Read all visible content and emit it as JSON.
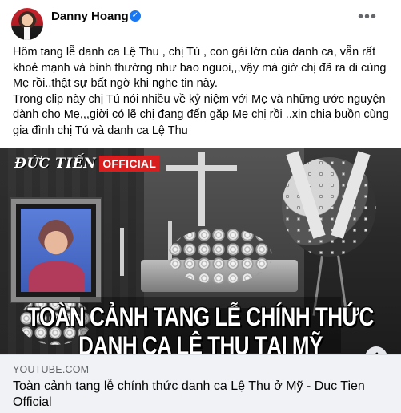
{
  "post": {
    "author": "Danny Hoang",
    "verified_icon": "verified-check-icon",
    "more_icon": "more-options-icon",
    "paragraph_1": "Hôm tang lễ danh ca Lệ Thu , chị Tú , con gái lớn của danh ca, vẫn rất khoẻ mạnh và bình thường như bao nguoi,,,vậy mà giờ chị đã ra di cùng Mẹ rồi..thật sự bất ngờ khi nghe tin này.",
    "paragraph_2": "Trong clip này chị Tú nói nhiều về kỷ niệm với Mẹ và những ước nguyện dành cho Mẹ,,,giời có lẽ chị đang đến gặp Mẹ chị rồi ..xin chia buồn cùng gia đình chị Tú và danh ca Lệ Thu"
  },
  "media": {
    "logo_part_1": "ĐỨC TIẾN",
    "logo_part_2": "OFFICIAL",
    "caption_line_1": "TOÀN CẢNH TANG LỄ CHÍNH THỨC",
    "caption_line_2": "DANH CA LỆ THU TẠI MỸ",
    "info_icon": "i"
  },
  "link_preview": {
    "domain": "YOUTUBE.COM",
    "title": "Toàn cảnh tang lễ chính thức danh ca Lệ Thu ở Mỹ - Duc Tien Official"
  },
  "colors": {
    "verified": "#1877f2",
    "preview_bg": "#f0f2f5",
    "logo_red": "#d81e1e"
  }
}
